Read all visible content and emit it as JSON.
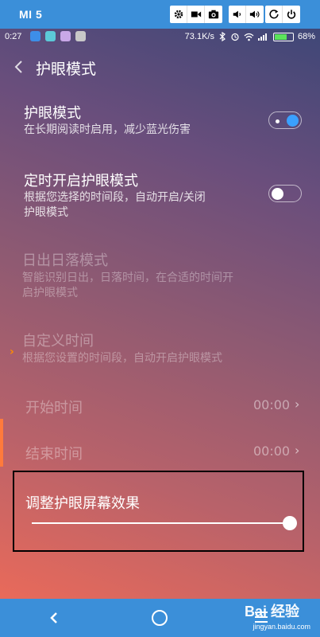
{
  "emulator": {
    "title": "MI 5",
    "icons": [
      "gear-icon",
      "video-icon",
      "camera-icon",
      "volume-down-icon",
      "volume-up-icon",
      "rotate-icon",
      "power-icon"
    ]
  },
  "status_bar": {
    "time": "0:27",
    "speed": "73.1K/s",
    "battery": "68%",
    "battery_level": 0.68
  },
  "header": {
    "title": "护眼模式"
  },
  "settings": {
    "eye_mode": {
      "title": "护眼模式",
      "subtitle": "在长期阅读时启用，减少蓝光伤害",
      "enabled": true
    },
    "scheduled": {
      "title": "定时开启护眼模式",
      "subtitle_line1": "根据您选择的时间段，自动开启/关闭",
      "subtitle_line2": "护眼模式",
      "enabled": false
    },
    "sunrise_sunset": {
      "title": "日出日落模式",
      "subtitle_line1": "智能识别日出，日落时间，在合适的时间开",
      "subtitle_line2": "启护眼模式"
    },
    "custom_time": {
      "title": "自定义时间",
      "subtitle": "根据您设置的时间段，自动开启护眼模式"
    },
    "start_time": {
      "label": "开始时间",
      "value": "00:00"
    },
    "end_time": {
      "label": "结束时间",
      "value": "00:00"
    },
    "effect": {
      "label": "调整护眼屏幕效果",
      "slider_value": 1.0
    }
  },
  "watermark": {
    "brand": "Bai 经验",
    "url": "jingyan.baidu.com"
  },
  "colors": {
    "accent": "#3aa0ff",
    "bar": "#3b8fd9",
    "gradient_top": "#3f4777",
    "gradient_bottom": "#e96a5a"
  }
}
